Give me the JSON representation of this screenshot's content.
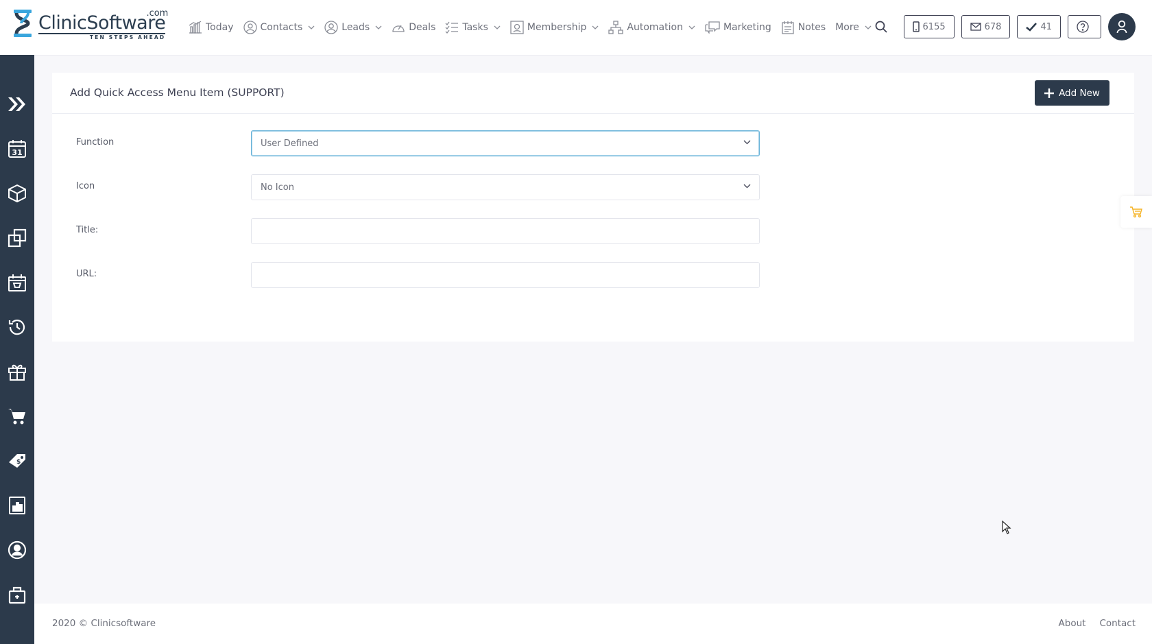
{
  "brand": {
    "name": "ClinicSoftware",
    "domain_suffix": ".com",
    "tagline": "TEN STEPS AHEAD"
  },
  "nav": {
    "items": [
      {
        "label": "Today",
        "icon": "chart-bars-icon",
        "has_dropdown": false
      },
      {
        "label": "Contacts",
        "icon": "contacts-icon",
        "has_dropdown": true
      },
      {
        "label": "Leads",
        "icon": "user-circle-icon",
        "has_dropdown": true
      },
      {
        "label": "Deals",
        "icon": "gauge-icon",
        "has_dropdown": false
      },
      {
        "label": "Tasks",
        "icon": "checklist-icon",
        "has_dropdown": true
      },
      {
        "label": "Membership",
        "icon": "membership-card-icon",
        "has_dropdown": true
      },
      {
        "label": "Automation",
        "icon": "hierarchy-icon",
        "has_dropdown": true
      },
      {
        "label": "Marketing",
        "icon": "chat-bubbles-icon",
        "has_dropdown": false
      },
      {
        "label": "Notes",
        "icon": "notes-icon",
        "has_dropdown": false
      },
      {
        "label": "More",
        "icon": "",
        "has_dropdown": true
      }
    ]
  },
  "header_actions": {
    "sms_count": "6155",
    "email_count": "678",
    "tasks_count": "41"
  },
  "sidebar": {
    "items": [
      {
        "icon": "double-chevron-right-icon"
      },
      {
        "icon": "calendar-31-icon"
      },
      {
        "icon": "cube-icon"
      },
      {
        "icon": "copy-squares-icon"
      },
      {
        "icon": "basket-calendar-icon"
      },
      {
        "icon": "history-icon"
      },
      {
        "icon": "gift-icon"
      },
      {
        "icon": "shopping-cart-icon"
      },
      {
        "icon": "price-tag-icon"
      },
      {
        "icon": "report-chart-icon"
      },
      {
        "icon": "user-circle-icon"
      },
      {
        "icon": "lock-bag-icon"
      }
    ]
  },
  "card": {
    "title": "Add Quick Access Menu Item (SUPPORT)",
    "add_new_label": "Add New"
  },
  "form": {
    "function": {
      "label": "Function",
      "value": "User Defined"
    },
    "icon": {
      "label": "Icon",
      "value": "No Icon"
    },
    "title": {
      "label": "Title:",
      "value": ""
    },
    "url": {
      "label": "URL:",
      "value": ""
    }
  },
  "footer": {
    "copyright": "2020 © Clinicsoftware",
    "links": [
      "About",
      "Contact"
    ]
  },
  "colors": {
    "sidebar_bg": "#2c3a4b",
    "button_bg": "#2c3a4b",
    "focus_border": "#69b3d8",
    "cart_accent": "#f5b324",
    "page_bg": "#f7f7fa"
  }
}
